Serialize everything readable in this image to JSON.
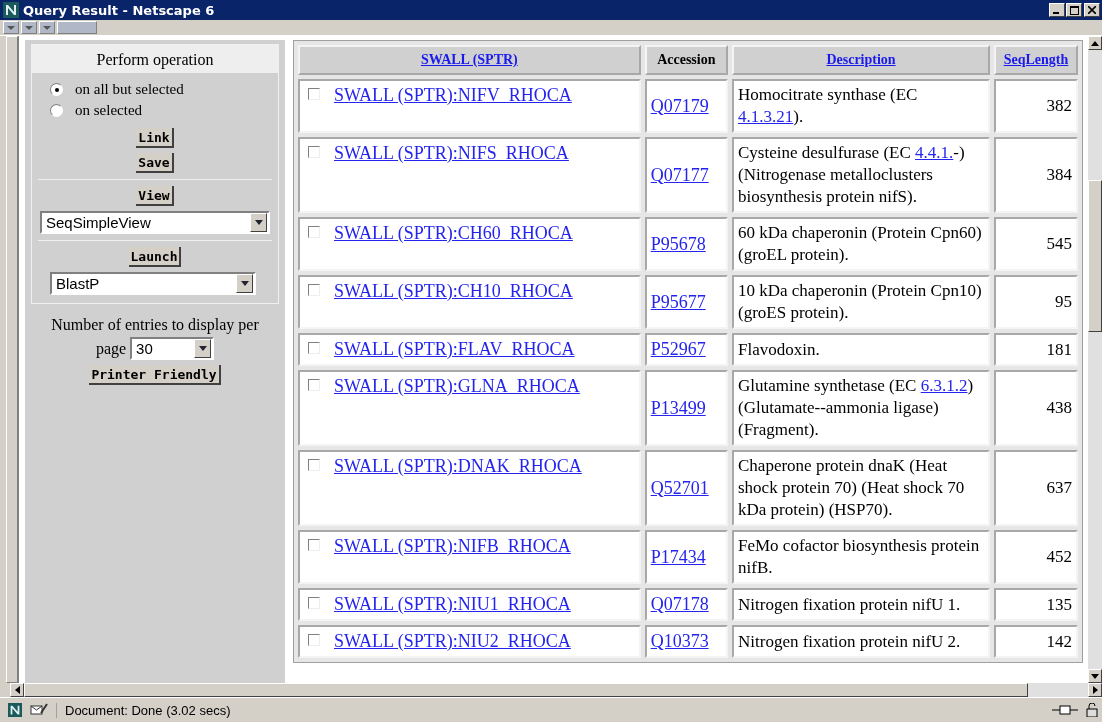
{
  "window": {
    "title": "Query Result - Netscape 6"
  },
  "operation_panel": {
    "title": "Perform operation",
    "radios": [
      {
        "label": "on all but selected",
        "selected": true
      },
      {
        "label": "on selected",
        "selected": false
      }
    ],
    "link_button": "Link",
    "save_button": "Save",
    "view_button": "View",
    "view_select": "SeqSimpleView",
    "launch_button": "Launch",
    "launch_select": "BlastP"
  },
  "entries_label": "Number of entries to display per",
  "page_label": "page",
  "page_select": "30",
  "printer_button": "Printer Friendly",
  "table": {
    "columns": [
      {
        "label": "SWALL (SPTR)",
        "link": true
      },
      {
        "label": "Accession",
        "link": false
      },
      {
        "label": "Description",
        "link": true
      },
      {
        "label": "SeqLength",
        "link": true
      }
    ],
    "rows": [
      {
        "checked": false,
        "entry": "SWALL (SPTR):NIFV_RHOCA",
        "accession": "Q07179",
        "description": [
          {
            "text": "Homocitrate synthase (EC "
          },
          {
            "link": "4.1.3.21"
          },
          {
            "text": ")."
          }
        ],
        "length": "382"
      },
      {
        "checked": false,
        "entry": "SWALL (SPTR):NIFS_RHOCA",
        "accession": "Q07177",
        "description": [
          {
            "text": "Cysteine desulfurase (EC "
          },
          {
            "link": "4.4.1."
          },
          {
            "text": "-) (Nitrogenase metalloclusters biosynthesis protein nifS)."
          }
        ],
        "length": "384"
      },
      {
        "checked": false,
        "entry": "SWALL (SPTR):CH60_RHOCA",
        "accession": "P95678",
        "description": [
          {
            "text": "60 kDa chaperonin (Protein Cpn60) (groEL protein)."
          }
        ],
        "length": "545"
      },
      {
        "checked": false,
        "entry": "SWALL (SPTR):CH10_RHOCA",
        "accession": "P95677",
        "description": [
          {
            "text": "10 kDa chaperonin (Protein Cpn10) (groES protein)."
          }
        ],
        "length": "95"
      },
      {
        "checked": false,
        "entry": "SWALL (SPTR):FLAV_RHOCA",
        "accession": "P52967",
        "description": [
          {
            "text": "Flavodoxin."
          }
        ],
        "length": "181"
      },
      {
        "checked": false,
        "entry": "SWALL (SPTR):GLNA_RHOCA",
        "accession": "P13499",
        "description": [
          {
            "text": "Glutamine synthetase (EC "
          },
          {
            "link": "6.3.1.2"
          },
          {
            "text": ") (Glutamate--ammonia ligase) (Fragment)."
          }
        ],
        "length": "438"
      },
      {
        "checked": false,
        "entry": "SWALL (SPTR):DNAK_RHOCA",
        "accession": "Q52701",
        "description": [
          {
            "text": "Chaperone protein dnaK (Heat shock protein 70) (Heat shock 70 kDa protein) (HSP70)."
          }
        ],
        "length": "637"
      },
      {
        "checked": false,
        "entry": "SWALL (SPTR):NIFB_RHOCA",
        "accession": "P17434",
        "description": [
          {
            "text": "FeMo cofactor biosynthesis protein nifB."
          }
        ],
        "length": "452"
      },
      {
        "checked": false,
        "entry": "SWALL (SPTR):NIU1_RHOCA",
        "accession": "Q07178",
        "description": [
          {
            "text": "Nitrogen fixation protein nifU 1."
          }
        ],
        "length": "135"
      },
      {
        "checked": false,
        "entry": "SWALL (SPTR):NIU2_RHOCA",
        "accession": "Q10373",
        "description": [
          {
            "text": "Nitrogen fixation protein nifU 2."
          }
        ],
        "length": "142"
      }
    ]
  },
  "status_bar": {
    "text": "Document: Done (3.02 secs)"
  }
}
